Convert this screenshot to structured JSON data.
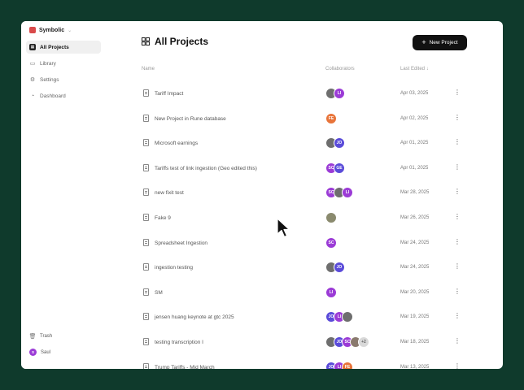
{
  "brand": {
    "name": "Symbolic"
  },
  "sidebar": {
    "items": [
      {
        "label": "All Projects",
        "icon": "grid-icon"
      },
      {
        "label": "Library",
        "icon": "book-icon"
      },
      {
        "label": "Settings",
        "icon": "gear-icon"
      },
      {
        "label": "Dashboard",
        "icon": "dashboard-icon"
      }
    ],
    "footer": {
      "trash": {
        "label": "Trash",
        "icon": "trash-icon"
      },
      "user": {
        "label": "Saul",
        "initials": "S"
      }
    }
  },
  "main": {
    "title": "All Projects",
    "new_button": "New Project",
    "columns": {
      "name": "Name",
      "collaborators": "Collaborators",
      "last_edited": "Last Edited ↓"
    },
    "rows": [
      {
        "name": "Tariff Impact",
        "date": "Apr 03, 2025",
        "avatars": [
          {
            "t": "",
            "c": "#6e6e6e"
          },
          {
            "t": "LI",
            "c": "#9b3bd6"
          }
        ]
      },
      {
        "name": "New Project in Rune database",
        "date": "Apr 02, 2025",
        "avatars": [
          {
            "t": "FE",
            "c": "#e8743a"
          }
        ]
      },
      {
        "name": "Microsoft earnings",
        "date": "Apr 01, 2025",
        "avatars": [
          {
            "t": "",
            "c": "#6e6e6e"
          },
          {
            "t": "JO",
            "c": "#5a4bd9"
          }
        ]
      },
      {
        "name": "Tariffs test of link ingestion (Geo edited this)",
        "date": "Apr 01, 2025",
        "avatars": [
          {
            "t": "SC",
            "c": "#9b3bd6"
          },
          {
            "t": "GE",
            "c": "#5a4bd9"
          }
        ]
      },
      {
        "name": "new fixit test",
        "date": "Mar 28, 2025",
        "avatars": [
          {
            "t": "SC",
            "c": "#9b3bd6"
          },
          {
            "t": "",
            "c": "#6e6e6e"
          },
          {
            "t": "LI",
            "c": "#9b3bd6"
          }
        ]
      },
      {
        "name": "Fake 9",
        "date": "Mar 26, 2025",
        "avatars": [
          {
            "t": "",
            "c": "#8a8a6e"
          }
        ]
      },
      {
        "name": "Spreadsheet Ingestion",
        "date": "Mar 24, 2025",
        "avatars": [
          {
            "t": "SC",
            "c": "#9b3bd6"
          }
        ]
      },
      {
        "name": "ingestion testing",
        "date": "Mar 24, 2025",
        "avatars": [
          {
            "t": "",
            "c": "#6e6e6e"
          },
          {
            "t": "JO",
            "c": "#5a4bd9"
          }
        ]
      },
      {
        "name": "SM",
        "date": "Mar 20, 2025",
        "avatars": [
          {
            "t": "LI",
            "c": "#9b3bd6"
          }
        ]
      },
      {
        "name": "jensen huang keynote at gtc 2025",
        "date": "Mar 19, 2025",
        "avatars": [
          {
            "t": "JO",
            "c": "#5a4bd9"
          },
          {
            "t": "LI",
            "c": "#9b3bd6"
          },
          {
            "t": "",
            "c": "#6e6e6e"
          }
        ]
      },
      {
        "name": "testing transcription I",
        "date": "Mar 18, 2025",
        "avatars": [
          {
            "t": "",
            "c": "#6e6e6e"
          },
          {
            "t": "JO",
            "c": "#5a4bd9"
          },
          {
            "t": "SC",
            "c": "#9b3bd6"
          },
          {
            "t": "",
            "c": "#8a7a6e"
          },
          {
            "t": "+2",
            "c": "#d9d9d9"
          }
        ]
      },
      {
        "name": "Trump Tariffs - Mid March",
        "date": "Mar 13, 2025",
        "avatars": [
          {
            "t": "JO",
            "c": "#5a4bd9"
          },
          {
            "t": "LI",
            "c": "#9b3bd6"
          },
          {
            "t": "FE",
            "c": "#e8743a"
          }
        ]
      }
    ]
  }
}
